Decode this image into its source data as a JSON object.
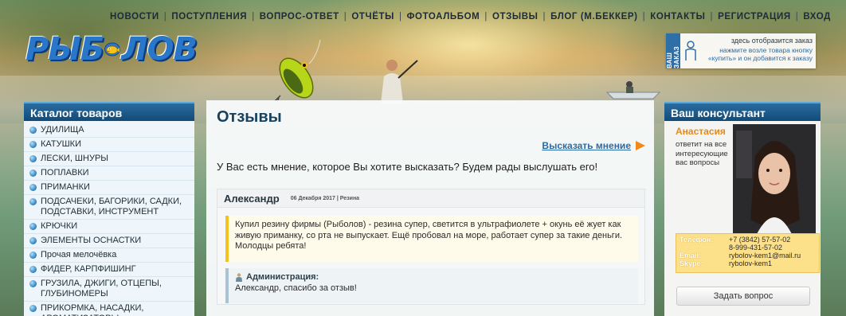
{
  "nav": {
    "items": [
      "НОВОСТИ",
      "ПОСТУПЛЕНИЯ",
      "ВОПРОС-ОТВЕТ",
      "ОТЧЁТЫ",
      "ФОТОАЛЬБОМ",
      "ОТЗЫВЫ",
      "БЛОГ (М.БЕККЕР)",
      "КОНТАКТЫ",
      "РЕГИСТРАЦИЯ",
      "ВХОД"
    ],
    "separator": "|"
  },
  "logo": {
    "left": "РЫБ",
    "right": "ЛОВ"
  },
  "order": {
    "tab": "ВАШ ЗАКАЗ",
    "line1": "здесь отобразится заказ",
    "line2": "нажмите возле товара кнопку «купить» и он добавится к заказу"
  },
  "catalog": {
    "title": "Каталог товаров",
    "items": [
      "УДИЛИЩА",
      "КАТУШКИ",
      "ЛЕСКИ, ШНУРЫ",
      "ПОПЛАВКИ",
      "ПРИМАНКИ",
      "ПОДСАЧЕКИ, БАГОРИКИ, САДКИ, ПОДСТАВКИ, ИНСТРУМЕНТ",
      "КРЮЧКИ",
      "ЭЛЕМЕНТЫ ОСНАСТКИ",
      "Прочая мелочёвка",
      "ФИДЕР, КАРПФИШИНГ",
      "ГРУЗИЛА, ДЖИГИ, ОТЦЕПЫ, ГЛУБИНОМЕРЫ",
      "ПРИКОРМКА, НАСАДКИ, АРОМАТИЗАТОРЫ"
    ]
  },
  "main": {
    "title": "Отзывы",
    "opinion_link": "Высказать мнение",
    "intro": "У Вас есть мнение, которое Вы хотите высказать? Будем рады выслушать его!",
    "review": {
      "author": "Александр",
      "meta": "06 Декабря 2017 | Резина",
      "text": "Купил резину фирмы (Рыболов) - резина супер, светится в ультрафиолете + окунь её жует как живую приманку, со рта не выпускает. Ещё пробовал на море, работает супер за такие деньги. Молодцы ребята!",
      "admin_label": "Администрация:",
      "admin_text": "Александр, спасибо за отзыв!"
    }
  },
  "consultant": {
    "title": "Ваш консультант",
    "name": "Анастасия",
    "description": "ответит на все интересующие вас вопросы",
    "contacts": [
      {
        "label": "Телефон:",
        "value": "+7 (3842) 57-57-02"
      },
      {
        "label": "",
        "value": "8-999-431-57-02"
      },
      {
        "label": "Email:",
        "value": "rybolov-kem1@mail.ru"
      },
      {
        "label": "Skype:",
        "value": "rybolov-kem1"
      }
    ],
    "ask_button": "Задать вопрос"
  },
  "colors": {
    "accent": "#114b78",
    "orange": "#e48a1a",
    "link": "#2a6aa6"
  }
}
